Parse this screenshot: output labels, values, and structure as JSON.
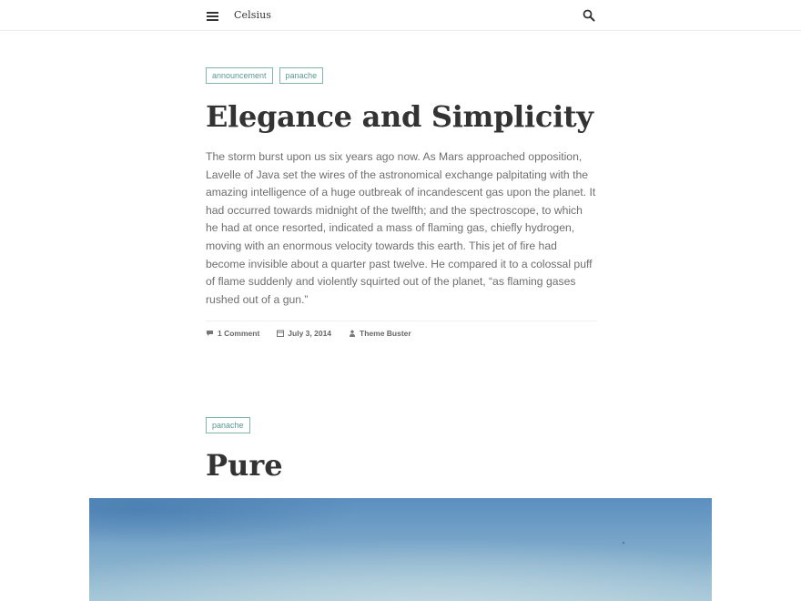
{
  "header": {
    "site_title": "Celsius",
    "menu_icon": "hamburger-menu-icon",
    "search_icon": "search-icon"
  },
  "posts": [
    {
      "tags": [
        "announcement",
        "panache"
      ],
      "title": "Elegance and Simplicity",
      "excerpt": "The storm burst upon us six years ago now. As Mars approached opposition, Lavelle of Java set the wires of the astronomical exchange palpitating with the amazing intelligence of a huge outbreak of incandescent gas upon the planet. It had occurred towards midnight of the twelfth; and the spectroscope, to which he had at once resorted, indicated a mass of flaming gas, chiefly hydrogen, moving with an enormous velocity towards this earth. This jet of fire had become invisible about a quarter past twelve. He compared it to a colossal puff of flame suddenly and violently squirted out of the planet, “as flaming gases rushed out of a gun.”",
      "meta": {
        "comments": "1 Comment",
        "date": "July 3, 2014",
        "author": "Theme Buster"
      }
    },
    {
      "tags": [
        "panache"
      ],
      "title": "Pure"
    }
  ],
  "colors": {
    "tag_border": "#7fb5ad",
    "tag_text": "#5a9a92",
    "text": "#333333",
    "excerpt_text": "#6e6e6e",
    "sky_top": "#5b8fbf",
    "sky_bottom": "#9fc3d5"
  }
}
